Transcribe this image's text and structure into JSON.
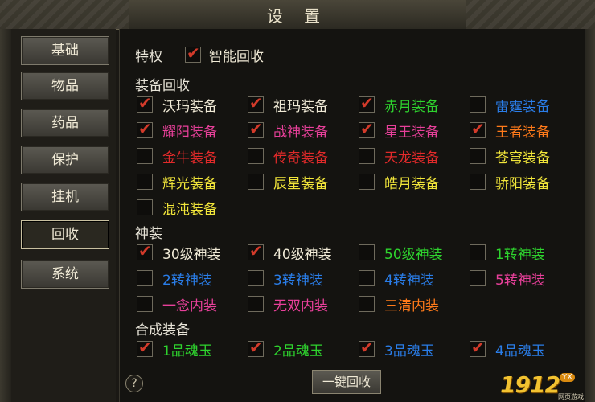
{
  "window": {
    "title": "设 置"
  },
  "sidebar": {
    "items": [
      {
        "label": "基础",
        "active": false
      },
      {
        "label": "物品",
        "active": false
      },
      {
        "label": "药品",
        "active": false
      },
      {
        "label": "保护",
        "active": false
      },
      {
        "label": "挂机",
        "active": false
      },
      {
        "label": "回收",
        "active": true
      },
      {
        "label": "系统",
        "active": false
      }
    ]
  },
  "privilege": {
    "label": "特权",
    "option": {
      "label": "智能回收",
      "checked": true
    }
  },
  "sections": {
    "equip": {
      "title": "装备回收",
      "items": [
        {
          "label": "沃玛装备",
          "checked": true,
          "color": "#f0ead6"
        },
        {
          "label": "祖玛装备",
          "checked": true,
          "color": "#f0ead6"
        },
        {
          "label": "赤月装备",
          "checked": true,
          "color": "#2ed32e"
        },
        {
          "label": "雷霆装备",
          "checked": false,
          "color": "#2a7de8"
        },
        {
          "label": "耀阳装备",
          "checked": true,
          "color": "#e8409a"
        },
        {
          "label": "战神装备",
          "checked": true,
          "color": "#e8409a"
        },
        {
          "label": "星王装备",
          "checked": true,
          "color": "#e8409a"
        },
        {
          "label": "王者装备",
          "checked": true,
          "color": "#ff7a1a"
        },
        {
          "label": "金牛装备",
          "checked": false,
          "color": "#e02a2a"
        },
        {
          "label": "传奇装备",
          "checked": false,
          "color": "#e02a2a"
        },
        {
          "label": "天龙装备",
          "checked": false,
          "color": "#e02a2a"
        },
        {
          "label": "苍穹装备",
          "checked": false,
          "color": "#f2e63a"
        },
        {
          "label": "辉光装备",
          "checked": false,
          "color": "#f2e63a"
        },
        {
          "label": "辰星装备",
          "checked": false,
          "color": "#f2e63a"
        },
        {
          "label": "皓月装备",
          "checked": false,
          "color": "#f2e63a"
        },
        {
          "label": "骄阳装备",
          "checked": false,
          "color": "#f2e63a"
        },
        {
          "label": "混沌装备",
          "checked": false,
          "color": "#f2e63a"
        }
      ]
    },
    "god": {
      "title": "神装",
      "items": [
        {
          "label": "30级神装",
          "checked": true,
          "color": "#f0ead6"
        },
        {
          "label": "40级神装",
          "checked": true,
          "color": "#f0ead6"
        },
        {
          "label": "50级神装",
          "checked": false,
          "color": "#2ed32e"
        },
        {
          "label": "1转神装",
          "checked": false,
          "color": "#2ed32e"
        },
        {
          "label": "2转神装",
          "checked": false,
          "color": "#2a7de8"
        },
        {
          "label": "3转神装",
          "checked": false,
          "color": "#2a7de8"
        },
        {
          "label": "4转神装",
          "checked": false,
          "color": "#2a7de8"
        },
        {
          "label": "5转神装",
          "checked": false,
          "color": "#e8409a"
        },
        {
          "label": "一念内装",
          "checked": false,
          "color": "#e8409a"
        },
        {
          "label": "无双内装",
          "checked": false,
          "color": "#e8409a"
        },
        {
          "label": "三清内装",
          "checked": false,
          "color": "#ff7a1a"
        }
      ]
    },
    "compose": {
      "title": "合成装备",
      "items": [
        {
          "label": "1品魂玉",
          "checked": true,
          "color": "#2ed32e"
        },
        {
          "label": "2品魂玉",
          "checked": true,
          "color": "#2ed32e"
        },
        {
          "label": "3品魂玉",
          "checked": true,
          "color": "#2a7de8"
        },
        {
          "label": "4品魂玉",
          "checked": true,
          "color": "#2a7de8"
        }
      ]
    }
  },
  "footer": {
    "help": "?",
    "onekey_label": "一键回收"
  },
  "logo": {
    "number": "1912",
    "badge": "YX",
    "sub": "网页游戏"
  }
}
